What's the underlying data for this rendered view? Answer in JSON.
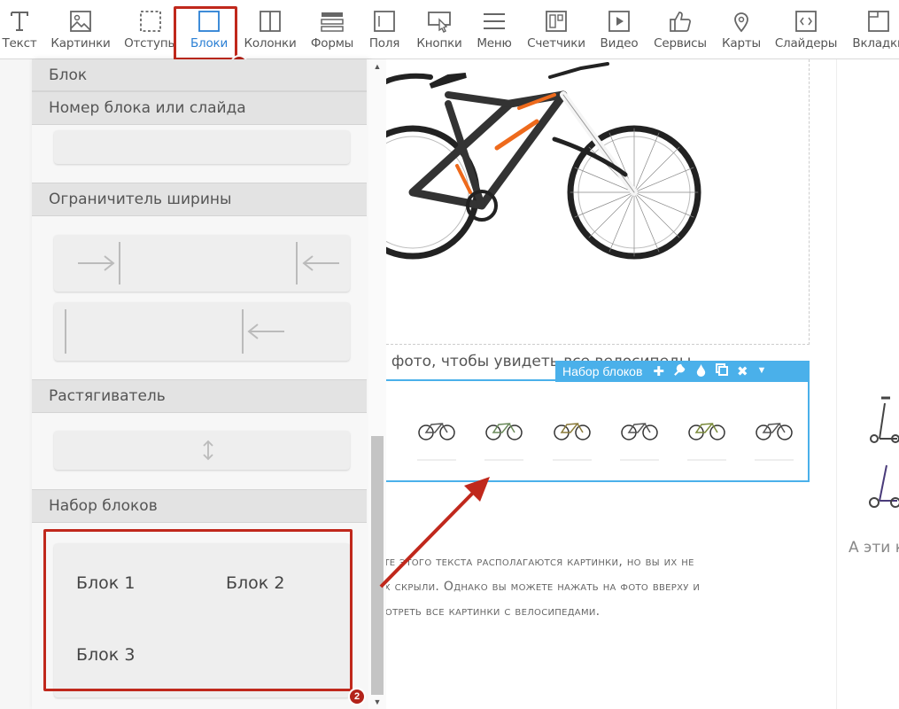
{
  "toolbar": {
    "items": [
      {
        "label": "Текст",
        "icon": "text-icon"
      },
      {
        "label": "Картинки",
        "icon": "image-icon"
      },
      {
        "label": "Отступы",
        "icon": "padding-icon"
      },
      {
        "label": "Блоки",
        "icon": "block-icon"
      },
      {
        "label": "Колонки",
        "icon": "columns-icon"
      },
      {
        "label": "Формы",
        "icon": "form-icon"
      },
      {
        "label": "Поля",
        "icon": "fields-icon"
      },
      {
        "label": "Кнопки",
        "icon": "button-icon"
      },
      {
        "label": "Меню",
        "icon": "menu-icon"
      },
      {
        "label": "Счетчики",
        "icon": "counter-icon"
      },
      {
        "label": "Видео",
        "icon": "video-icon"
      },
      {
        "label": "Сервисы",
        "icon": "thumbs-up-icon"
      },
      {
        "label": "Карты",
        "icon": "map-pin-icon"
      },
      {
        "label": "Слайдеры",
        "icon": "slider-icon"
      },
      {
        "label": "Вкладки",
        "icon": "tabs-icon"
      }
    ],
    "active": "Блоки",
    "accent": "#2a7fd4"
  },
  "badges": {
    "one": "1",
    "two": "2"
  },
  "panel": {
    "top_section": "Блок",
    "block_number_title": "Номер блока или слайда",
    "width_limiter_title": "Ограничитель ширины",
    "stretcher_title": "Растягиватель",
    "block_set_title": "Набор блоков",
    "block_set_items": [
      "Блок 1",
      "Блок 2",
      "Блок 3"
    ]
  },
  "content": {
    "caption": "а фото, чтобы увидеть все велосипеды",
    "block_set_header": "Набор блоков",
    "body_text_lines": [
      "сте этого текста располагаются картинки, но вы их не",
      "их скрыли. Однако вы можете нажать на фото вверху и",
      "мотреть все картинки с велосипедами."
    ],
    "right_text": "А эти к"
  },
  "colors": {
    "highlight": "#c0281c",
    "selection": "#4ab0ea"
  }
}
